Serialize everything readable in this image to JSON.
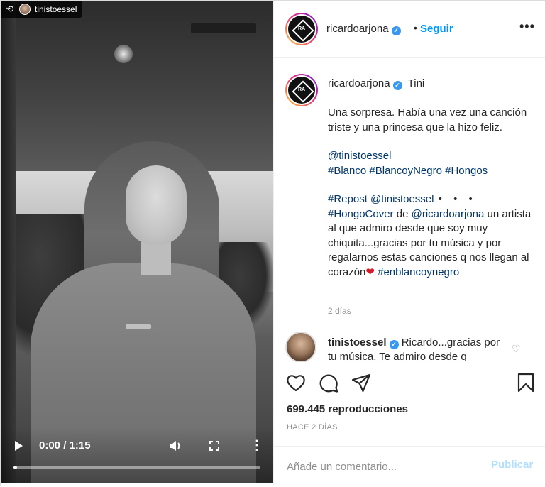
{
  "repost": {
    "icon": "repost-icon",
    "username": "tinistoessel"
  },
  "video": {
    "current_time": "0:00 / 1:15",
    "progress": 0.0,
    "icons": {
      "play": "play-icon",
      "volume": "volume-icon",
      "fullscreen": "fullscreen-icon",
      "more": "more-vertical-icon"
    }
  },
  "header": {
    "username": "ricardoarjona",
    "separator": "•",
    "follow_label": "Seguir",
    "options_label": "•••"
  },
  "caption": {
    "username": "ricardoarjona",
    "title": "Tini",
    "paragraph1": "Una sorpresa. Había una vez una canción triste y una princesa que la hizo feliz.",
    "mention1": "@tinistoessel",
    "hashtags1": [
      "#Blanco",
      "#BlancoyNegro",
      "#Hongos"
    ],
    "repost_tag": "#Repost",
    "repost_mention": "@tinistoessel",
    "repost_dots": "• • •",
    "hongo_tag": "#HongoCover",
    "de_word": "de",
    "ricardo_mention": "@ricardoarjona",
    "paragraph3_rest": "un artista al que admiro desde que soy muy chiquita...gracias por tu música y por regalarnos estas canciones q nos llegan al corazón",
    "heart": "❤",
    "final_tag": "#enblancoynegro",
    "age": "2 días"
  },
  "reply": {
    "username": "tinistoessel",
    "text": "Ricardo...gracias por tu música. Te admiro desde q"
  },
  "actions": {
    "views": "699.445 reproducciones",
    "posted_ago": "HACE 2 DÍAS"
  },
  "comment_box": {
    "placeholder": "Añade un comentario...",
    "post_label": "Publicar"
  },
  "colors": {
    "link_blue": "#0095f6",
    "tag_blue": "#00376b",
    "verified_blue": "#3897f0",
    "muted": "#8e8e8e",
    "post_disabled": "#b2dffc"
  }
}
